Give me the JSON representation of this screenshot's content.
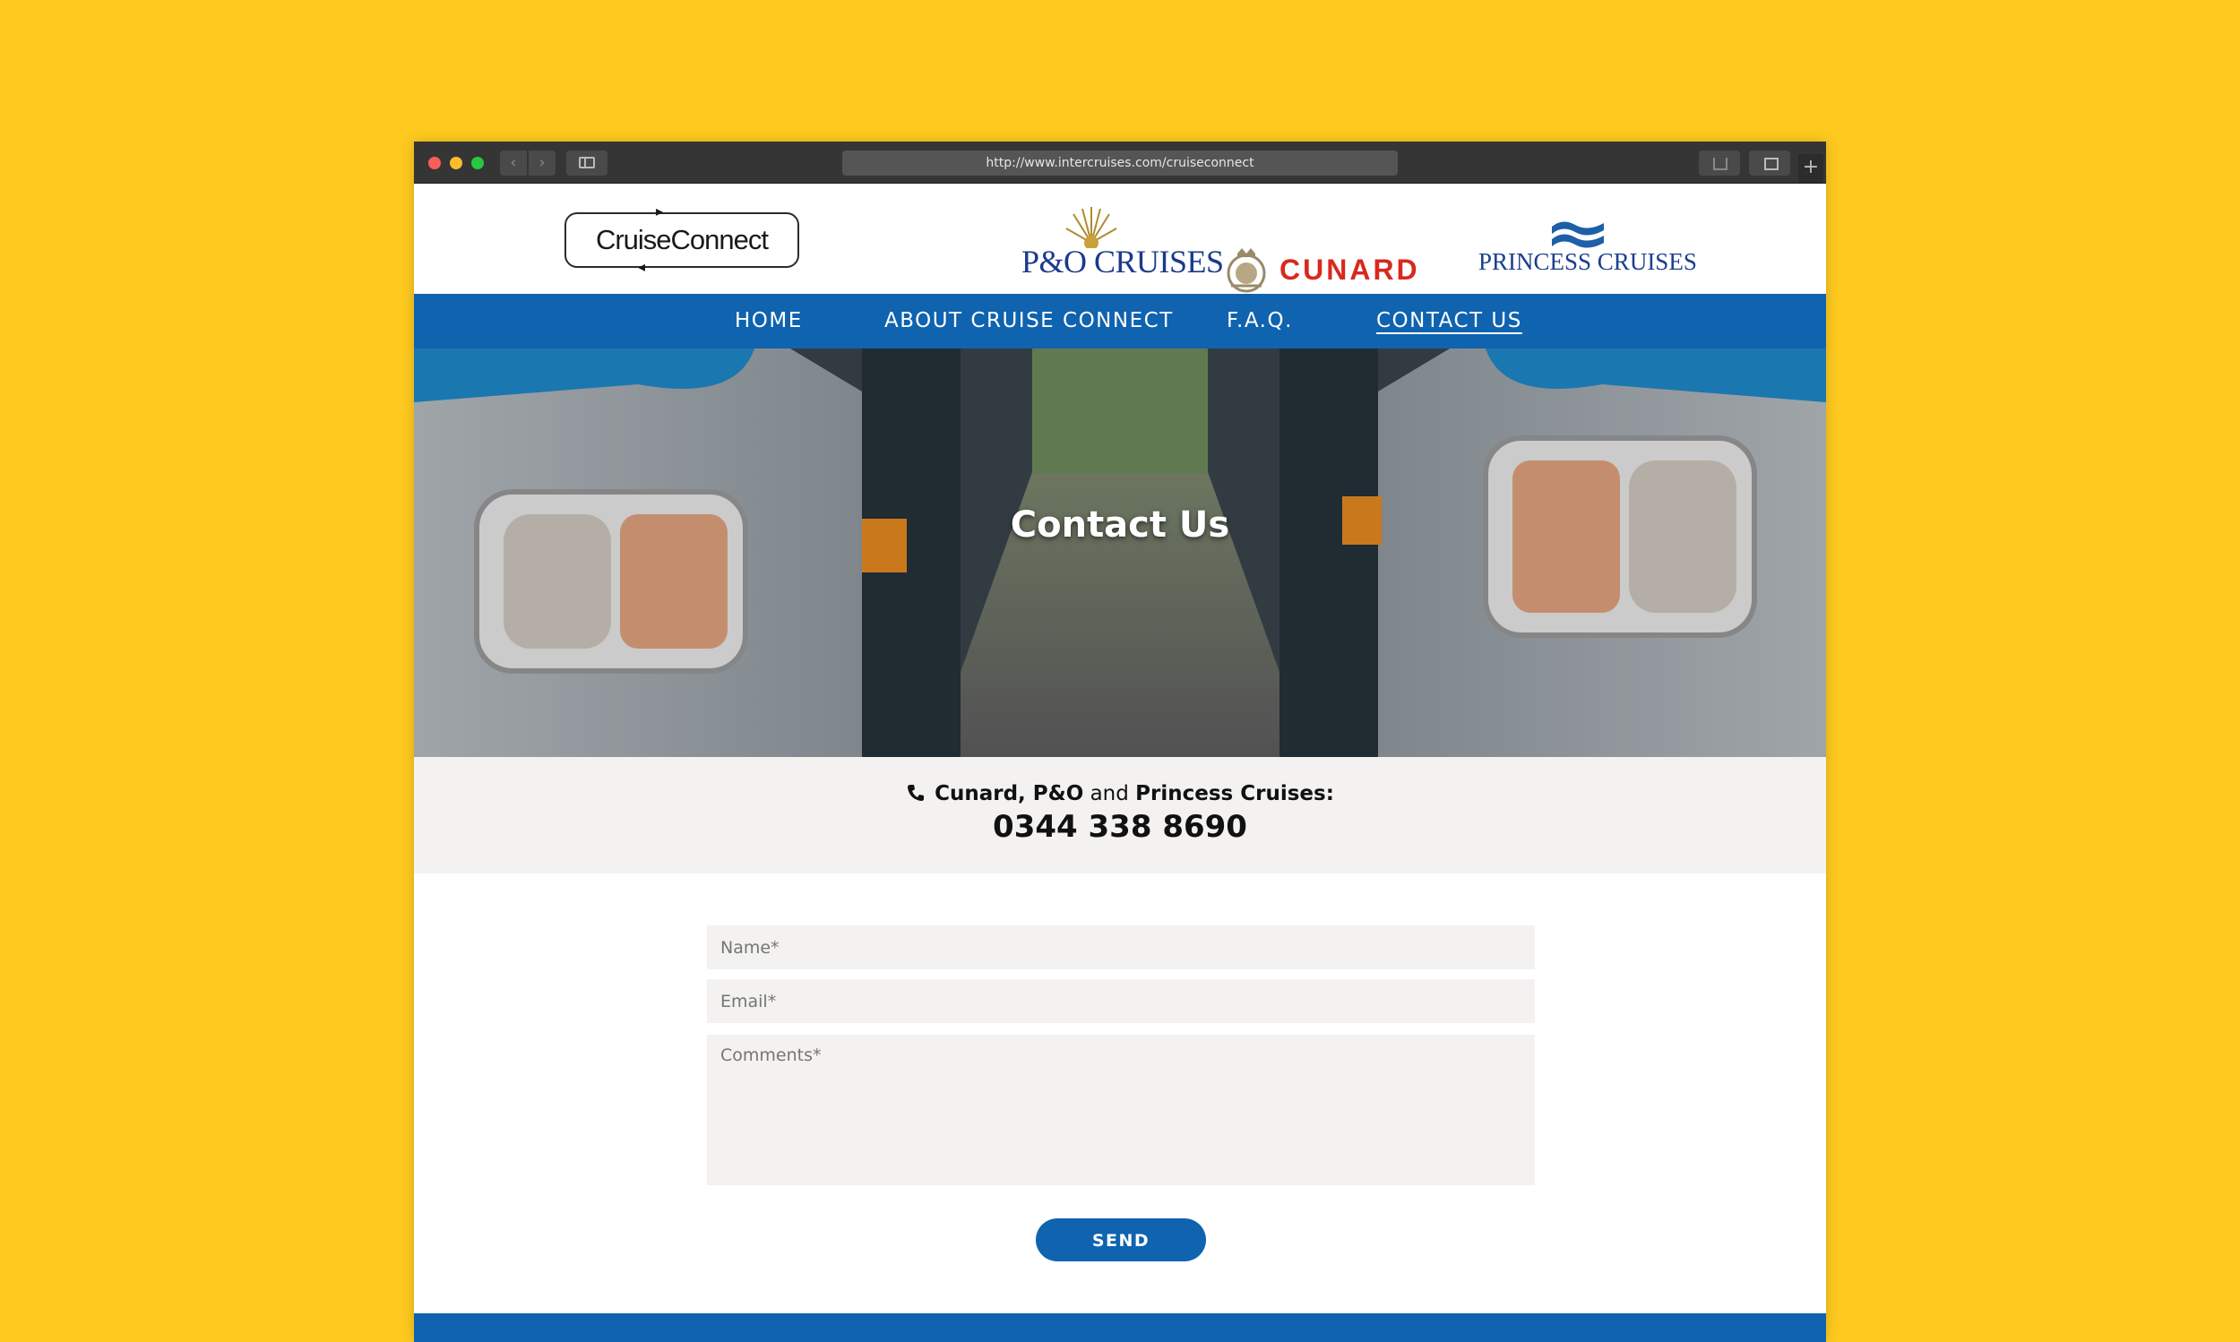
{
  "browser": {
    "url": "http://www.intercruises.com/cruiseconnect"
  },
  "header": {
    "logo_text": "CruiseConnect",
    "brands": {
      "po": "P&O CRUISES",
      "cunard": "CUNARD",
      "princess": "PRINCESS CRUISES"
    }
  },
  "nav": {
    "items": [
      {
        "label": "HOME"
      },
      {
        "label": "ABOUT CRUISE CONNECT"
      },
      {
        "label": "F.A.Q."
      },
      {
        "label": "CONTACT US"
      }
    ],
    "active": "CONTACT US"
  },
  "hero": {
    "title": "Contact Us"
  },
  "contact": {
    "label_strong_1": "Cunard, P&O",
    "label_mid": " and ",
    "label_strong_2": "Princess Cruises:",
    "phone": "0344 338 8690"
  },
  "form": {
    "name_placeholder": "Name*",
    "email_placeholder": "Email*",
    "comments_placeholder": "Comments*",
    "send_label": "SEND"
  },
  "colors": {
    "background": "#FFCA1F",
    "nav_blue": "#0F63AF",
    "cunard_red": "#D8291E",
    "brand_blue": "#1D3F8F",
    "panel_grey": "#F3F2F1"
  }
}
